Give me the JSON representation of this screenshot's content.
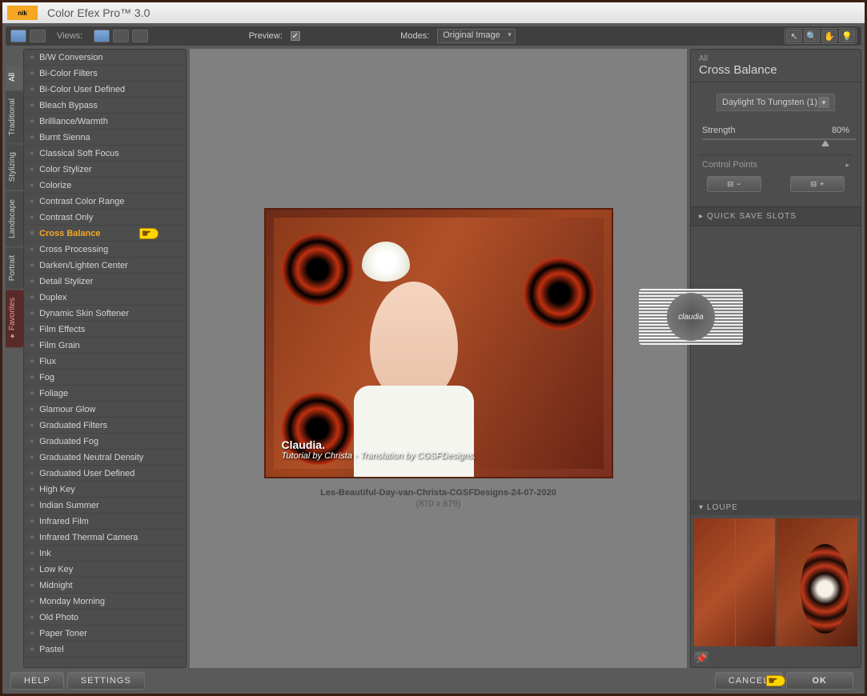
{
  "app": {
    "logo_text": "nik",
    "title": "Color Efex Pro™ 3.0"
  },
  "toolbar": {
    "views_label": "Views:",
    "preview_label": "Preview:",
    "preview_checked": true,
    "modes_label": "Modes:",
    "modes_value": "Original Image"
  },
  "categories": [
    {
      "label": "All",
      "active": true
    },
    {
      "label": "Traditional",
      "active": false
    },
    {
      "label": "Stylizing",
      "active": false
    },
    {
      "label": "Landscape",
      "active": false
    },
    {
      "label": "Portrait",
      "active": false
    },
    {
      "label": "Favorites",
      "active": false,
      "fav": true
    }
  ],
  "filters": [
    "B/W Conversion",
    "Bi-Color Filters",
    "Bi-Color User Defined",
    "Bleach Bypass",
    "Brilliance/Warmth",
    "Burnt Sienna",
    "Classical Soft Focus",
    "Color Stylizer",
    "Colorize",
    "Contrast Color Range",
    "Contrast Only",
    "Cross Balance",
    "Cross Processing",
    "Darken/Lighten Center",
    "Detail Stylizer",
    "Duplex",
    "Dynamic Skin Softener",
    "Film Effects",
    "Film Grain",
    "Flux",
    "Fog",
    "Foliage",
    "Glamour Glow",
    "Graduated Filters",
    "Graduated Fog",
    "Graduated Neutral Density",
    "Graduated User Defined",
    "High Key",
    "Indian Summer",
    "Infrared Film",
    "Infrared Thermal Camera",
    "Ink",
    "Low Key",
    "Midnight",
    "Monday Morning",
    "Old Photo",
    "Paper Toner",
    "Pastel"
  ],
  "selected_filter": "Cross Balance",
  "canvas": {
    "name": "Claudia.",
    "credit": "Tutorial by Christa - Translation by CGSFDesigns.",
    "filename": "Les-Beautiful-Day-van-Christa-CGSFDesigns-24-07-2020",
    "dimensions": "(870 x 679)",
    "watermark": "claudia"
  },
  "right": {
    "category": "All",
    "title": "Cross Balance",
    "method_value": "Daylight To Tungsten (1)",
    "strength_label": "Strength",
    "strength_value": "80%",
    "control_points_label": "Control Points",
    "cp_minus": "−",
    "cp_plus": "+",
    "quick_save": "QUICK SAVE SLOTS",
    "loupe": "LOUPE"
  },
  "footer": {
    "help": "HELP",
    "settings": "SETTINGS",
    "cancel": "CANCEL",
    "ok": "OK"
  }
}
